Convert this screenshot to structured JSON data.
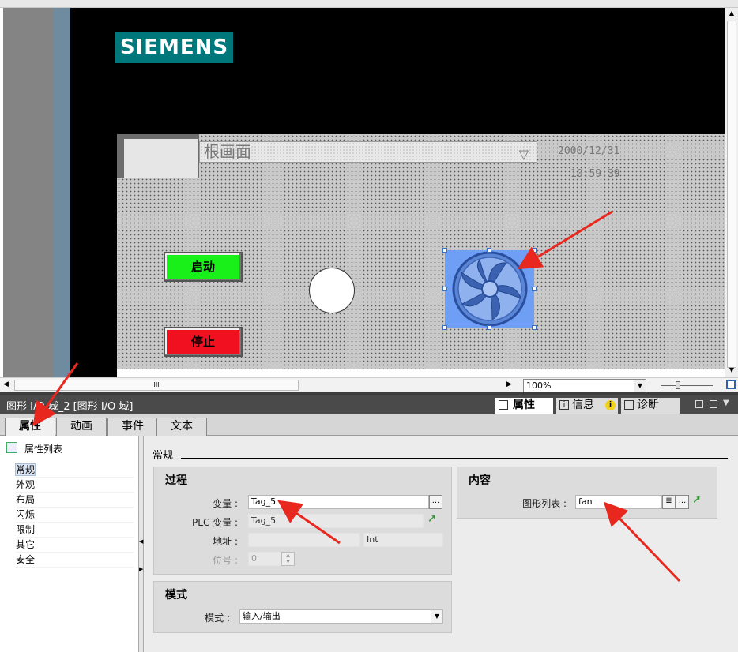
{
  "hmi_screen": {
    "logo_text": "SIEMENS",
    "screen_selector": "根画面",
    "date": "2000/12/31",
    "time": "10:59:39",
    "start_button": "启动",
    "stop_button": "停止"
  },
  "scroll": {
    "hscroll_grip": "III",
    "zoom_value": "100%"
  },
  "properties_header": {
    "title": "图形 I/O 域_2 [图形 I/O 域]",
    "tabs": [
      {
        "label": "属性"
      },
      {
        "label": "信息"
      },
      {
        "label": "诊断"
      }
    ]
  },
  "editor_tabs": [
    {
      "label": "属性",
      "active": true
    },
    {
      "label": "动画"
    },
    {
      "label": "事件"
    },
    {
      "label": "文本"
    }
  ],
  "nav": {
    "header": "属性列表",
    "items": [
      "常规",
      "外观",
      "布局",
      "闪烁",
      "限制",
      "其它",
      "安全"
    ]
  },
  "general": {
    "section_title": "常规",
    "process": {
      "title": "过程",
      "variable_label": "变量 :",
      "variable_value": "Tag_5",
      "plc_variable_label": "PLC 变量 :",
      "plc_variable_value": "Tag_5",
      "address_label": "地址 :",
      "address_value": "",
      "address_type": "Int",
      "bit_label": "位号 :",
      "bit_value": "0",
      "browse": "..."
    },
    "mode": {
      "title": "模式",
      "mode_label": "模式 :",
      "mode_value": "输入/输出"
    },
    "content": {
      "title": "内容",
      "graphic_list_label": "图形列表 :",
      "graphic_list_value": "fan",
      "browse": "..."
    }
  },
  "colors": {
    "start_green": "#19f019",
    "stop_red": "#f01020",
    "siemens_teal": "#00777a",
    "selection_blue": "#6f9ef5",
    "annotation_red": "#e8281e"
  }
}
